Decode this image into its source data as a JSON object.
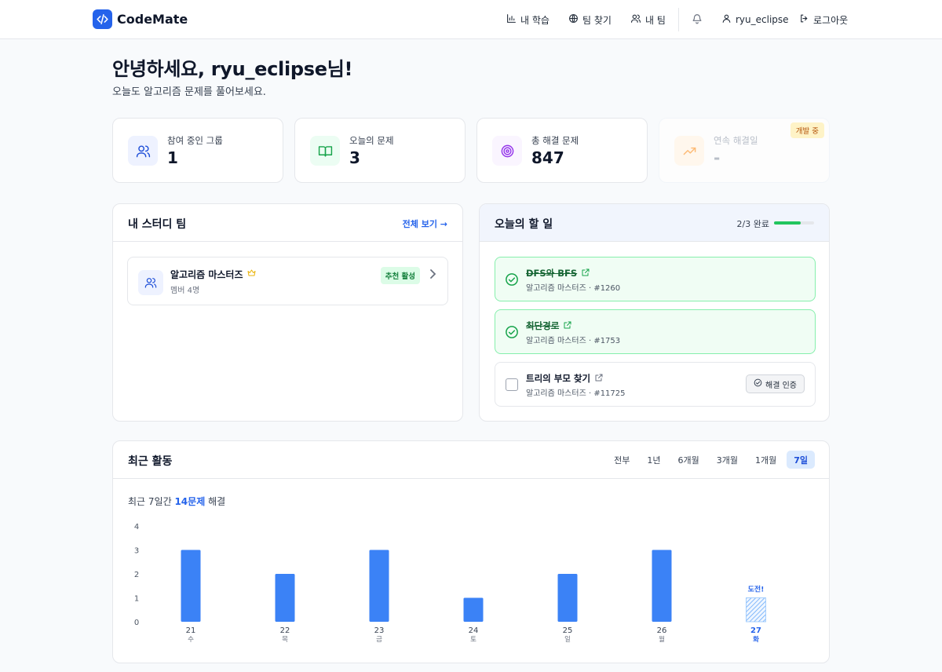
{
  "brand": {
    "name": "CodeMate"
  },
  "nav": {
    "my_learning": "내 학습",
    "find_team": "팀 찾기",
    "my_team": "내 팀",
    "username": "ryu_eclipse",
    "logout": "로그아웃"
  },
  "greeting": {
    "title": "안녕하세요, ryu_eclipse님!",
    "subtitle": "오늘도 알고리즘 문제를 풀어보세요."
  },
  "stats": [
    {
      "label": "참여 중인 그룹",
      "value": "1",
      "icon": "users-icon",
      "color": "#1d4ed8"
    },
    {
      "label": "오늘의 문제",
      "value": "3",
      "icon": "book-icon",
      "color": "#16a34a"
    },
    {
      "label": "총 해결 문제",
      "value": "847",
      "icon": "target-icon",
      "color": "#9333ea"
    },
    {
      "label": "연속 해결일",
      "value": "-",
      "icon": "trend-up-icon",
      "color": "#f97316",
      "badge": "개발 중"
    }
  ],
  "study_team": {
    "title": "내 스터디 팀",
    "view_all": "전체 보기 →",
    "teams": [
      {
        "name": "알고리즘 마스터즈",
        "members": "멤버 4명",
        "badge": "추천 활성"
      }
    ]
  },
  "todo": {
    "title": "오늘의 할 일",
    "progress_text": "2/3 완료",
    "progress": 0.667,
    "tasks": [
      {
        "title": "DFS와 BFS",
        "meta": "알고리즘 마스터즈 · #1260",
        "done": true
      },
      {
        "title": "최단경로",
        "meta": "알고리즘 마스터즈 · #1753",
        "done": true
      },
      {
        "title": "트리의 부모 찾기",
        "meta": "알고리즘 마스터즈 · #11725",
        "done": false,
        "action": "해결 인증"
      }
    ]
  },
  "activity": {
    "title": "최근 활동",
    "ranges": [
      "전부",
      "1년",
      "6개월",
      "3개월",
      "1개월",
      "7일"
    ],
    "active_range": "7일",
    "summary_prefix": "최근 7일간",
    "summary_count": "14문제",
    "summary_suffix": "해결"
  },
  "chart_data": {
    "type": "bar",
    "categories": [
      "21",
      "22",
      "23",
      "24",
      "25",
      "26",
      "27"
    ],
    "weekdays": [
      "수",
      "목",
      "금",
      "토",
      "일",
      "월",
      "화"
    ],
    "values": [
      3,
      2,
      3,
      1,
      2,
      3,
      null
    ],
    "ylim": [
      0,
      4
    ],
    "yticks": [
      0,
      1,
      2,
      3,
      4
    ],
    "today_index": 6,
    "today_label": "도전!",
    "bar_color": "#3b82f6",
    "today_color": "#2563eb"
  }
}
